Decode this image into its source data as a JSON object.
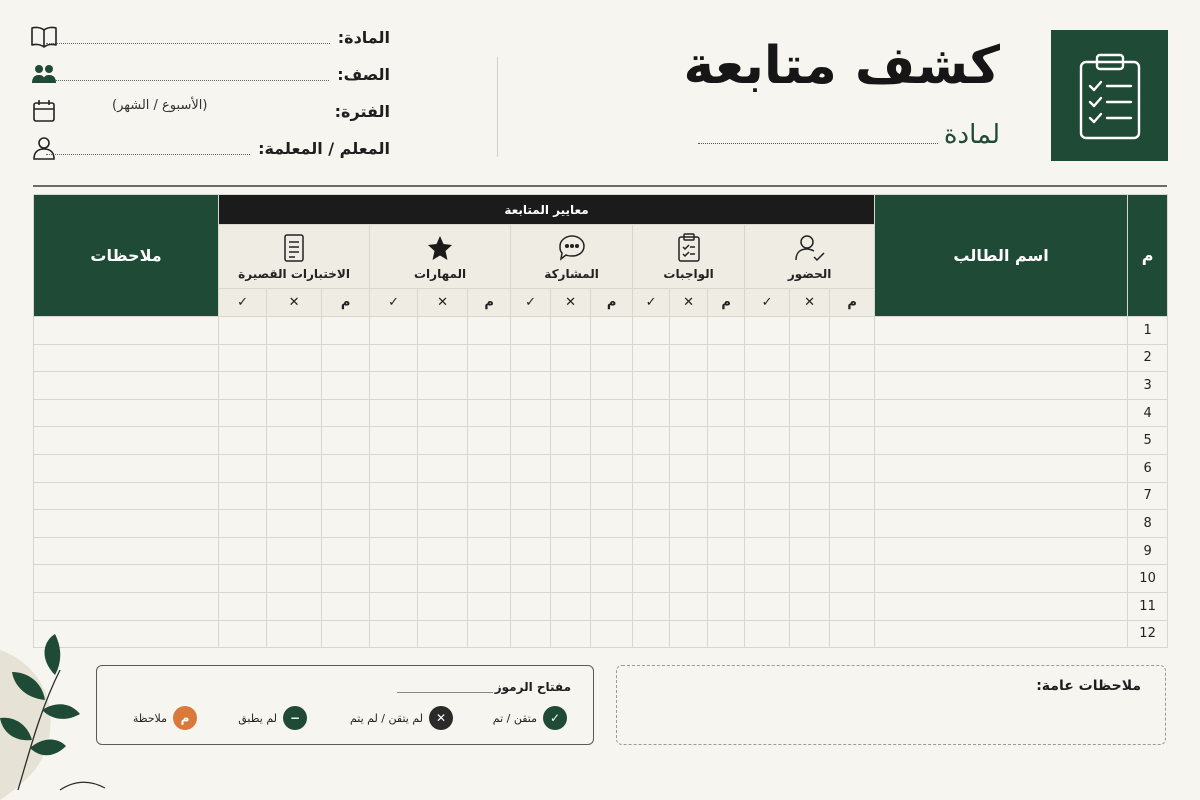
{
  "header": {
    "title": "كشف متابعة",
    "subtitle": "لمادة",
    "fields": [
      {
        "label": "المادة:",
        "hint": "",
        "icon": "book-icon"
      },
      {
        "label": "الصف:",
        "hint": "",
        "icon": "users-icon"
      },
      {
        "label": "الفترة:",
        "hint": "(الأسبوع / الشهر)",
        "icon": "calendar-icon"
      },
      {
        "label": "المعلم / المعلمة:",
        "hint": "",
        "icon": "user-icon"
      }
    ],
    "logo_icon": "clipboard-checklist-icon"
  },
  "table": {
    "col_num": "م",
    "col_name": "اسم الطالب",
    "col_notes": "ملاحظات",
    "criteria_header": "معايير المتابعة",
    "criteria": [
      {
        "label": "الحضور",
        "icon": "user-check-icon"
      },
      {
        "label": "الواجبات",
        "icon": "clipboard-check-icon"
      },
      {
        "label": "المشاركة",
        "icon": "chat-bubble-icon"
      },
      {
        "label": "المهارات",
        "icon": "star-icon"
      },
      {
        "label": "الاختبارات القصيرة",
        "icon": "document-icon"
      }
    ],
    "symbols": [
      "م",
      "✕",
      "✓"
    ],
    "rows": [
      "1",
      "2",
      "3",
      "4",
      "5",
      "6",
      "7",
      "8",
      "9",
      "10",
      "11",
      "12"
    ]
  },
  "legend": {
    "title": "مفتاح الرموز",
    "items": [
      {
        "label": "متقن / تم",
        "symbol": "✓",
        "color": "#1f4a35"
      },
      {
        "label": "لم يتقن / لم يتم",
        "symbol": "✕",
        "color": "#2a2a2a"
      },
      {
        "label": "لم يطبق",
        "symbol": "−",
        "color": "#1f4a35"
      },
      {
        "label": "ملاحظة",
        "symbol": "م",
        "color": "#d97a3a"
      }
    ]
  },
  "general_notes_label": "ملاحظات عامة:",
  "colors": {
    "primary": "#1f4a35",
    "accent": "#d97a3a",
    "background": "#f7f5ef"
  }
}
